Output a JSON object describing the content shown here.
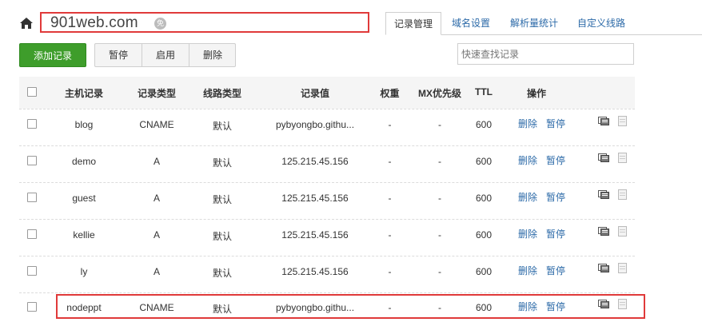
{
  "domain": {
    "name": "901web.com",
    "badge": "免"
  },
  "tabs": [
    {
      "label": "记录管理",
      "active": true
    },
    {
      "label": "域名设置",
      "active": false
    },
    {
      "label": "解析量统计",
      "active": false
    },
    {
      "label": "自定义线路",
      "active": false
    }
  ],
  "toolbar": {
    "add_label": "添加记录",
    "pause_label": "暂停",
    "enable_label": "启用",
    "delete_label": "删除"
  },
  "search": {
    "placeholder": "快速查找记录"
  },
  "table": {
    "headers": {
      "host": "主机记录",
      "type": "记录类型",
      "line": "线路类型",
      "value": "记录值",
      "weight": "权重",
      "mx": "MX优先级",
      "ttl": "TTL",
      "ops": "操作"
    },
    "rows": [
      {
        "host": "blog",
        "type": "CNAME",
        "line": "默认",
        "value": "pybyongbo.githu...",
        "weight": "-",
        "mx": "-",
        "ttl": "600",
        "del": "删除",
        "pause": "暂停"
      },
      {
        "host": "demo",
        "type": "A",
        "line": "默认",
        "value": "125.215.45.156",
        "weight": "-",
        "mx": "-",
        "ttl": "600",
        "del": "删除",
        "pause": "暂停"
      },
      {
        "host": "guest",
        "type": "A",
        "line": "默认",
        "value": "125.215.45.156",
        "weight": "-",
        "mx": "-",
        "ttl": "600",
        "del": "删除",
        "pause": "暂停"
      },
      {
        "host": "kellie",
        "type": "A",
        "line": "默认",
        "value": "125.215.45.156",
        "weight": "-",
        "mx": "-",
        "ttl": "600",
        "del": "删除",
        "pause": "暂停"
      },
      {
        "host": "ly",
        "type": "A",
        "line": "默认",
        "value": "125.215.45.156",
        "weight": "-",
        "mx": "-",
        "ttl": "600",
        "del": "删除",
        "pause": "暂停"
      },
      {
        "host": "nodeppt",
        "type": "CNAME",
        "line": "默认",
        "value": "pybyongbo.githu...",
        "weight": "-",
        "mx": "-",
        "ttl": "600",
        "del": "删除",
        "pause": "暂停"
      }
    ]
  },
  "icons": {
    "home": "home-icon",
    "remark": "remark-icon",
    "note": "note-icon"
  },
  "colors": {
    "accent_green": "#3e9d2b",
    "link_blue": "#2c6aa8",
    "highlight_red": "#e03a3a"
  }
}
